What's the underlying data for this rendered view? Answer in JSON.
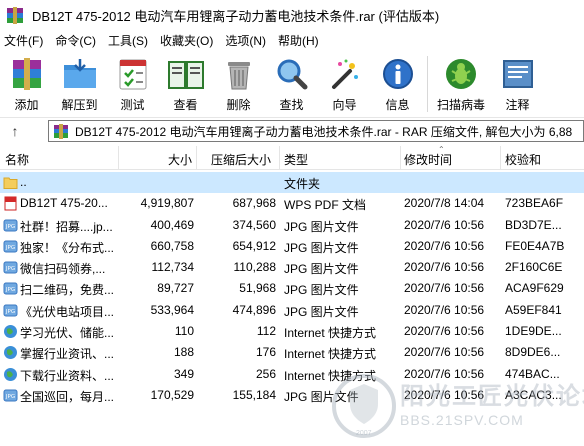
{
  "window": {
    "title": "DB12T 475-2012 电动汽车用锂离子动力蓄电池技术条件.rar (评估版本)"
  },
  "menu": [
    "文件(F)",
    "命令(C)",
    "工具(S)",
    "收藏夹(O)",
    "选项(N)",
    "帮助(H)"
  ],
  "toolbar": [
    {
      "label": "添加",
      "icon": "add-archive-icon"
    },
    {
      "label": "解压到",
      "icon": "extract-folder-icon"
    },
    {
      "label": "测试",
      "icon": "test-checklist-icon"
    },
    {
      "label": "查看",
      "icon": "view-book-icon"
    },
    {
      "label": "删除",
      "icon": "trash-icon"
    },
    {
      "label": "查找",
      "icon": "magnifier-icon"
    },
    {
      "label": "向导",
      "icon": "wizard-wand-icon"
    },
    {
      "label": "信息",
      "icon": "info-icon"
    },
    {
      "label": "扫描病毒",
      "icon": "virus-scan-icon"
    },
    {
      "label": "注释",
      "icon": "comment-icon"
    }
  ],
  "address": {
    "text": "DB12T 475-2012 电动汽车用锂离子动力蓄电池技术条件.rar - RAR 压缩文件, 解包大小为 6,88"
  },
  "columns": {
    "name": "名称",
    "size": "大小",
    "packed": "压缩后大小",
    "type": "类型",
    "modified": "修改时间",
    "crc": "校验和"
  },
  "rows": [
    {
      "icon": "folder-icon",
      "name": "..",
      "size": "",
      "packed": "",
      "type": "文件夹",
      "modified": "",
      "crc": ""
    },
    {
      "icon": "pdf-file-icon",
      "name": "DB12T 475-20...",
      "size": "4,919,807",
      "packed": "687,968",
      "type": "WPS PDF 文档",
      "modified": "2020/7/8 14:04",
      "crc": "723BEA6F"
    },
    {
      "icon": "jpg-file-icon",
      "name": "社群！招募....jp...",
      "size": "400,469",
      "packed": "374,560",
      "type": "JPG 图片文件",
      "modified": "2020/7/6 10:56",
      "crc": "BD3D7E..."
    },
    {
      "icon": "jpg-file-icon",
      "name": "独家！《分布式...",
      "size": "660,758",
      "packed": "654,912",
      "type": "JPG 图片文件",
      "modified": "2020/7/6 10:56",
      "crc": "FE0E4A7B"
    },
    {
      "icon": "jpg-file-icon",
      "name": "微信扫码领券,...",
      "size": "112,734",
      "packed": "110,288",
      "type": "JPG 图片文件",
      "modified": "2020/7/6 10:56",
      "crc": "2F160C6E"
    },
    {
      "icon": "jpg-file-icon",
      "name": "扫二维码，免费...",
      "size": "89,727",
      "packed": "51,968",
      "type": "JPG 图片文件",
      "modified": "2020/7/6 10:56",
      "crc": "ACA9F629"
    },
    {
      "icon": "jpg-file-icon",
      "name": "《光伏电站项目...",
      "size": "533,964",
      "packed": "474,896",
      "type": "JPG 图片文件",
      "modified": "2020/7/6 10:56",
      "crc": "A59EF841"
    },
    {
      "icon": "internet-shortcut-icon",
      "name": "学习光伏、储能...",
      "size": "110",
      "packed": "112",
      "type": "Internet 快捷方式",
      "modified": "2020/7/6 10:56",
      "crc": "1DE9DE..."
    },
    {
      "icon": "internet-shortcut-icon",
      "name": "掌握行业资讯、...",
      "size": "188",
      "packed": "176",
      "type": "Internet 快捷方式",
      "modified": "2020/7/6 10:56",
      "crc": "8D9DE6..."
    },
    {
      "icon": "internet-shortcut-icon",
      "name": "下载行业资料、...",
      "size": "349",
      "packed": "256",
      "type": "Internet 快捷方式",
      "modified": "2020/7/6 10:56",
      "crc": "474BAC..."
    },
    {
      "icon": "jpg-file-icon",
      "name": "全国巡回，每月...",
      "size": "170,529",
      "packed": "155,184",
      "type": "JPG 图片文件",
      "modified": "2020/7/6 10:56",
      "crc": "A3CAC3..."
    }
  ],
  "watermark": {
    "title": "阳光工匠光伏论坛",
    "url": "BBS.21SPV.COM",
    "year": "2007"
  }
}
